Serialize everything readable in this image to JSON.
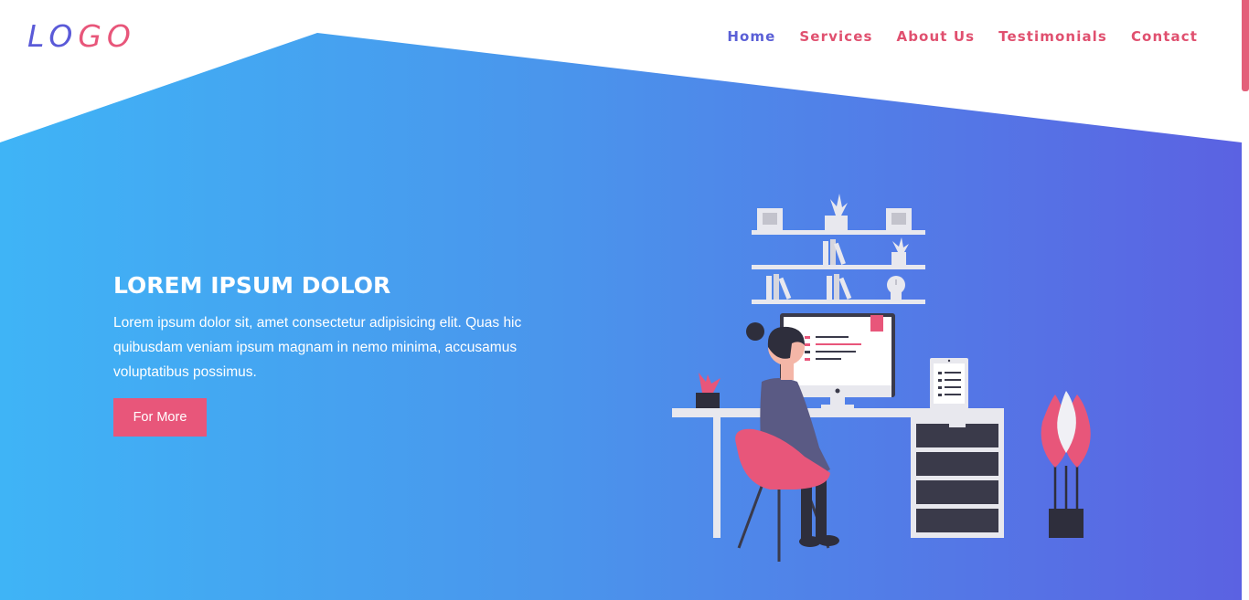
{
  "brand": {
    "logo_part1": "LO",
    "logo_part2": "GO"
  },
  "nav": {
    "items": [
      {
        "label": "Home",
        "active": true
      },
      {
        "label": "Services"
      },
      {
        "label": "About Us"
      },
      {
        "label": "Testimonials"
      },
      {
        "label": "Contact"
      }
    ]
  },
  "hero": {
    "title": "LOREM IPSUM DOLOR",
    "text": "Lorem ipsum dolor sit, amet consectetur adipisicing elit. Quas hic quibusdam veniam ipsum magnam in nemo minima, accusamus voluptatibus possimus.",
    "cta_label": "For More"
  },
  "colors": {
    "accent": "#e8567a",
    "nav_active": "#5a5fd6",
    "gradient_start": "#3fb4f6",
    "gradient_end": "#5b62e2"
  }
}
